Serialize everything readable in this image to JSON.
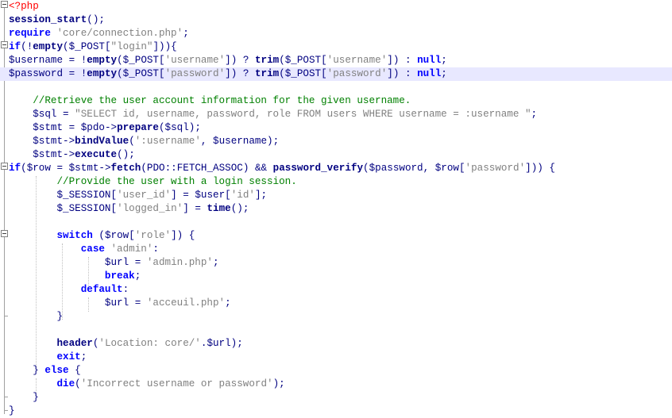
{
  "editor": {
    "language": "php",
    "current_line_index": 5,
    "colors": {
      "keyword": "#0000ff",
      "variable": "#000080",
      "string": "#808080",
      "comment": "#008000",
      "php_tag": "#ff0000",
      "current_line_bg": "#e8e8ff"
    },
    "lines": [
      "<?php",
      "session_start();",
      "require 'core/connection.php';",
      "if(!empty($_POST[\"login\"])){",
      "$username = !empty($_POST['username']) ? trim($_POST['username']) : null;",
      "$password = !empty($_POST['password']) ? trim($_POST['password']) : null;",
      "",
      "    //Retrieve the user account information for the given username.",
      "    $sql = \"SELECT id, username, password, role FROM users WHERE username = :username \";",
      "    $stmt = $pdo->prepare($sql);",
      "    $stmt->bindValue(':username', $username);",
      "    $stmt->execute();",
      "if($row = $stmt->fetch(PDO::FETCH_ASSOC) && password_verify($password, $row['password'])) {",
      "        //Provide the user with a login session.",
      "        $_SESSION['user_id'] = $user['id'];",
      "        $_SESSION['logged_in'] = time();",
      "",
      "        switch ($row['role']) {",
      "            case 'admin':",
      "                $url = 'admin.php';",
      "                break;",
      "            default:",
      "                $url = 'acceuil.php';",
      "        }",
      "",
      "        header('Location: core/'.$url);",
      "        exit;",
      "    } else {",
      "        die('Incorrect username or password');",
      "    }",
      "}"
    ]
  }
}
